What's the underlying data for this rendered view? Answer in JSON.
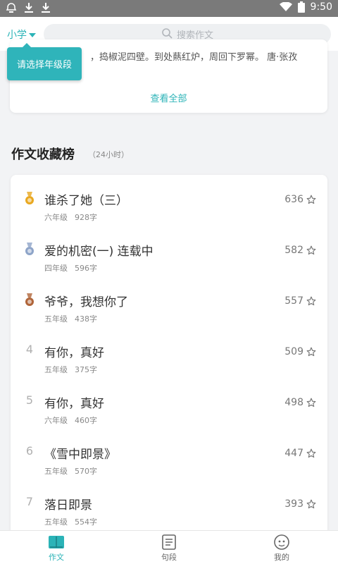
{
  "status_bar": {
    "time": "9:50",
    "icons": [
      "notification-icon",
      "download-icon",
      "download-icon",
      "wifi-icon",
      "battery-icon"
    ]
  },
  "header": {
    "grade_label": "小学",
    "search_placeholder": "搜索作文"
  },
  "tooltip": {
    "text": "请选择年级段"
  },
  "top_card": {
    "excerpt": "，捣椒泥四壁。到处爇红炉，周回下罗幂。 唐·张孜",
    "more_label": "查看全部"
  },
  "section": {
    "title": "作文收藏榜",
    "subtitle": "（24小时）"
  },
  "ranking": [
    {
      "rank": "1",
      "title": "谁杀了她（三）",
      "grade": "六年级",
      "words": "928字",
      "count": "636",
      "medal": "gold"
    },
    {
      "rank": "2",
      "title": "爱的机密(一) 连载中",
      "grade": "四年级",
      "words": "596字",
      "count": "582",
      "medal": "silver"
    },
    {
      "rank": "3",
      "title": "爷爷，我想你了",
      "grade": "五年级",
      "words": "438字",
      "count": "557",
      "medal": "bronze"
    },
    {
      "rank": "4",
      "title": "有你，真好",
      "grade": "五年级",
      "words": "375字",
      "count": "509",
      "medal": ""
    },
    {
      "rank": "5",
      "title": "有你，真好",
      "grade": "六年级",
      "words": "460字",
      "count": "498",
      "medal": ""
    },
    {
      "rank": "6",
      "title": "《雪中即景》",
      "grade": "五年级",
      "words": "570字",
      "count": "447",
      "medal": ""
    },
    {
      "rank": "7",
      "title": "落日即景",
      "grade": "五年级",
      "words": "554字",
      "count": "393",
      "medal": ""
    }
  ],
  "tabs": [
    {
      "label": "作文",
      "icon": "book-icon",
      "active": true
    },
    {
      "label": "句段",
      "icon": "document-icon",
      "active": false
    },
    {
      "label": "我的",
      "icon": "face-icon",
      "active": false
    }
  ],
  "colors": {
    "accent": "#2bb3b7",
    "gold": "#e9a820",
    "silver": "#8ea4c8",
    "bronze": "#b0653a"
  }
}
